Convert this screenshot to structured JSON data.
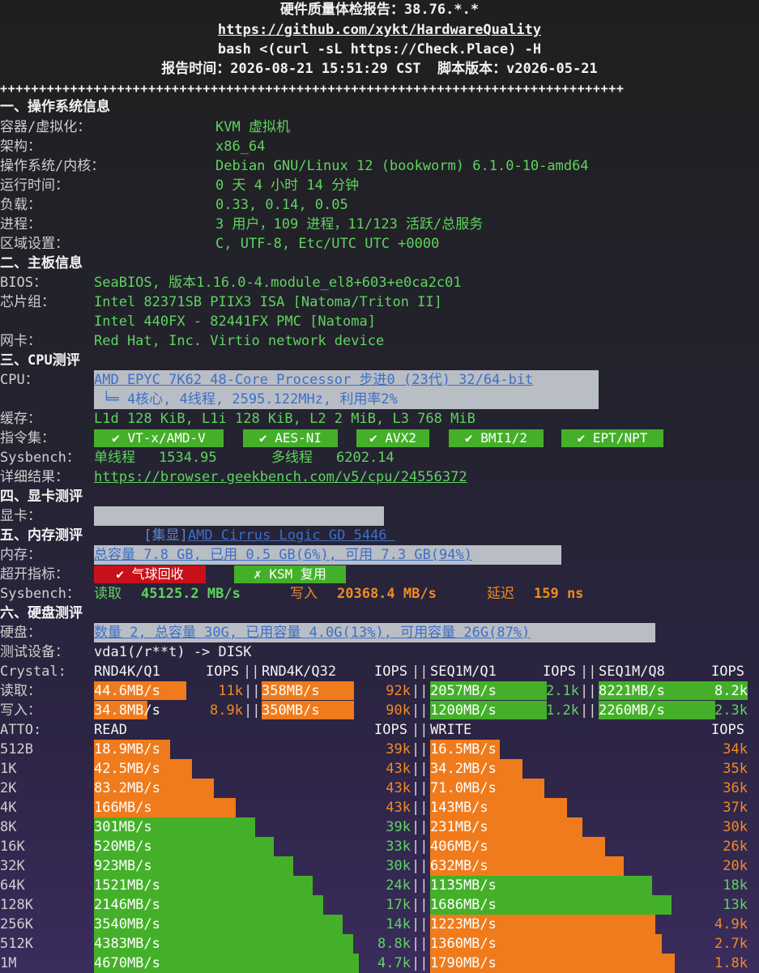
{
  "header": {
    "title": "硬件质量体检报告：38.76.*.*",
    "url": "https://github.com/xykt/HardwareQuality",
    "command": "bash <(curl -sL https://Check.Place) -H",
    "report_time": "报告时间：2026-08-21 15:51:29 CST  脚本版本：v2026-05-21",
    "divider": "++++++++++++++++++++++++++++++++++++++++++++++++++++++++++++++++++++++++++++++++"
  },
  "os": {
    "section": "一、操作系统信息",
    "rows": [
      {
        "label": "容器/虚拟化：",
        "value": "KVM 虚拟机"
      },
      {
        "label": "架构：",
        "value": "x86_64"
      },
      {
        "label": "操作系统/内核：",
        "value": "Debian GNU/Linux 12 (bookworm) 6.1.0-10-amd64"
      },
      {
        "label": "运行时间：",
        "value": "0 天 4 小时 14 分钟"
      },
      {
        "label": "负载：",
        "value": "0.33, 0.14, 0.05"
      },
      {
        "label": "进程：",
        "value": "3 用户，109 进程，11/123 活跃/总服务"
      },
      {
        "label": "区域设置：",
        "value": "C, UTF-8, Etc/UTC UTC +0000"
      }
    ]
  },
  "board": {
    "section": "二、主板信息",
    "bios_label": "BIOS：",
    "bios_value": "SeaBIOS, 版本1.16.0-4.module_el8+603+e0ca2c01",
    "chipset_label": "芯片组：",
    "chipset_1": "Intel 82371SB PIIX3 ISA [Natoma/Triton II]",
    "chipset_2": "Intel 440FX - 82441FX PMC [Natoma]",
    "nic_label": "网卡：",
    "nic_value": "Red Hat, Inc. Virtio network device"
  },
  "cpu": {
    "section": "三、CPU测评",
    "cpu_label": "CPU：",
    "cpu_model": "AMD EPYC 7K62 48-Core Processor 步进0 (23代) 32/64-bit",
    "cpu_detail": " ╘═ 4核心, 4线程, 2595.122MHz, 利用率2%",
    "cache_label": "缓存：",
    "cache_value": "L1d 128 KiB, L1i 128 KiB, L2 2 MiB, L3 768 MiB",
    "isa_label": "指令集：",
    "isa": [
      "✔ VT-x/AMD-V",
      "✔ AES-NI",
      "✔ AVX2",
      "✔ BMI1/2",
      "✔ EPT/NPT"
    ],
    "sysbench_label": "Sysbench：",
    "single_label": "单线程",
    "single_value": "1534.95",
    "multi_label": "多线程",
    "multi_value": "6202.14",
    "detail_label": "详细结果：",
    "detail_url": "https://browser.geekbench.com/v5/cpu/24556372"
  },
  "gpu": {
    "section": "四、显卡测评",
    "label": "显卡：",
    "tag": "[集显]",
    "value": "AMD Cirrus Logic GD 5446 "
  },
  "memory": {
    "section": "五、内存测评",
    "label": "内存：",
    "value": "总容量 7.8 GB, 已用 0.5 GB(6%), 可用 7.3 GB(94%)",
    "oc_label": "超开指标：",
    "balloon": "✔ 气球回收",
    "ksm": "✗ KSM 复用",
    "sysbench_label": "Sysbench：",
    "read_label": "读取",
    "read_value": "45125.2 MB/s",
    "write_label": "写入",
    "write_value": "20368.4 MB/s",
    "latency_label": "延迟",
    "latency_value": "159 ns"
  },
  "disk": {
    "section": "六、硬盘测评",
    "label": "硬盘：",
    "value": "数量 2, 总容量 30G, 已用容量 4.0G(13%), 可用容量 26G(87%)",
    "device_label": "测试设备：",
    "device_value": "vda1(/r**t) -> DISK",
    "crystal_label": "Crystal:",
    "crystal_headers": [
      "RND4K/Q1",
      "RND4K/Q32",
      "SEQ1M/Q1",
      "SEQ1M/Q8"
    ],
    "iops_label": "IOPS",
    "crystal_rows": [
      {
        "label": "读取：",
        "cells": [
          {
            "speed": "44.6MB/s",
            "iops": "11k",
            "fill": 0.62,
            "color": "#f07b1c"
          },
          {
            "speed": "358MB/s",
            "iops": "92k",
            "fill": 0.62,
            "color": "#f07b1c"
          },
          {
            "speed": "2057MB/s",
            "iops": "2.1k",
            "fill": 0.78,
            "color": "#44b02a"
          },
          {
            "speed": "8221MB/s",
            "iops": "8.2k",
            "fill": 1.0,
            "color": "#44b02a"
          }
        ]
      },
      {
        "label": "写入：",
        "cells": [
          {
            "speed": "34.8MB/s",
            "iops": "8.9k",
            "fill": 0.36,
            "color": "#f07b1c"
          },
          {
            "speed": "350MB/s",
            "iops": "90k",
            "fill": 0.62,
            "color": "#f07b1c"
          },
          {
            "speed": "1200MB/s",
            "iops": "1.2k",
            "fill": 0.78,
            "color": "#44b02a"
          },
          {
            "speed": "2260MB/s",
            "iops": "2.3k",
            "fill": 0.78,
            "color": "#44b02a"
          }
        ]
      }
    ],
    "atto_label": "ATTO:",
    "read_header": "READ",
    "write_header": "WRITE",
    "atto_rows": [
      {
        "size": "512B",
        "r": "18.9MB/s",
        "ri": "39k",
        "rf": 0.28,
        "rc": "#f07b1c",
        "w": "16.5MB/s",
        "wi": "34k",
        "wf": 0.22,
        "wc": "#f07b1c"
      },
      {
        "size": "1K",
        "r": "42.5MB/s",
        "ri": "43k",
        "rf": 0.36,
        "rc": "#f07b1c",
        "w": "34.2MB/s",
        "wi": "35k",
        "wf": 0.29,
        "wc": "#f07b1c"
      },
      {
        "size": "2K",
        "r": "83.2MB/s",
        "ri": "43k",
        "rf": 0.44,
        "rc": "#f07b1c",
        "w": "71.0MB/s",
        "wi": "36k",
        "wf": 0.36,
        "wc": "#f07b1c"
      },
      {
        "size": "4K",
        "r": "166MB/s",
        "ri": "43k",
        "rf": 0.52,
        "rc": "#f07b1c",
        "w": "143MB/s",
        "wi": "37k",
        "wf": 0.43,
        "wc": "#f07b1c"
      },
      {
        "size": "8K",
        "r": "301MB/s",
        "ri": "39k",
        "rf": 0.59,
        "rc": "#44b02a",
        "w": "231MB/s",
        "wi": "30k",
        "wf": 0.48,
        "wc": "#f07b1c"
      },
      {
        "size": "16K",
        "r": "520MB/s",
        "ri": "33k",
        "rf": 0.66,
        "rc": "#44b02a",
        "w": "406MB/s",
        "wi": "26k",
        "wf": 0.55,
        "wc": "#f07b1c"
      },
      {
        "size": "32K",
        "r": "923MB/s",
        "ri": "30k",
        "rf": 0.73,
        "rc": "#44b02a",
        "w": "632MB/s",
        "wi": "20k",
        "wf": 0.61,
        "wc": "#f07b1c"
      },
      {
        "size": "64K",
        "r": "1521MB/s",
        "ri": "24k",
        "rf": 0.8,
        "rc": "#44b02a",
        "w": "1135MB/s",
        "wi": "18k",
        "wf": 0.7,
        "wc": "#44b02a"
      },
      {
        "size": "128K",
        "r": "2146MB/s",
        "ri": "17k",
        "rf": 0.84,
        "rc": "#44b02a",
        "w": "1686MB/s",
        "wi": "13k",
        "wf": 0.76,
        "wc": "#44b02a"
      },
      {
        "size": "256K",
        "r": "3540MB/s",
        "ri": "14k",
        "rf": 0.91,
        "rc": "#44b02a",
        "w": "1223MB/s",
        "wi": "4.9k",
        "wf": 0.71,
        "wc": "#f07b1c"
      },
      {
        "size": "512K",
        "r": "4383MB/s",
        "ri": "8.8k",
        "rf": 0.95,
        "rc": "#44b02a",
        "w": "1360MB/s",
        "wi": "2.7k",
        "wf": 0.73,
        "wc": "#f07b1c"
      },
      {
        "size": "1M",
        "r": "4670MB/s",
        "ri": "4.7k",
        "rf": 0.97,
        "rc": "#44b02a",
        "w": "1790MB/s",
        "wi": "1.8k",
        "wf": 0.77,
        "wc": "#f07b1c"
      }
    ]
  },
  "colors": {
    "green_text": "#5fd35f",
    "orange_text": "#f08a24",
    "bar_orange": "#f07b1c",
    "bar_green": "#44b02a",
    "badge_red": "#c8101a",
    "link_blue": "#3d6fc8"
  }
}
